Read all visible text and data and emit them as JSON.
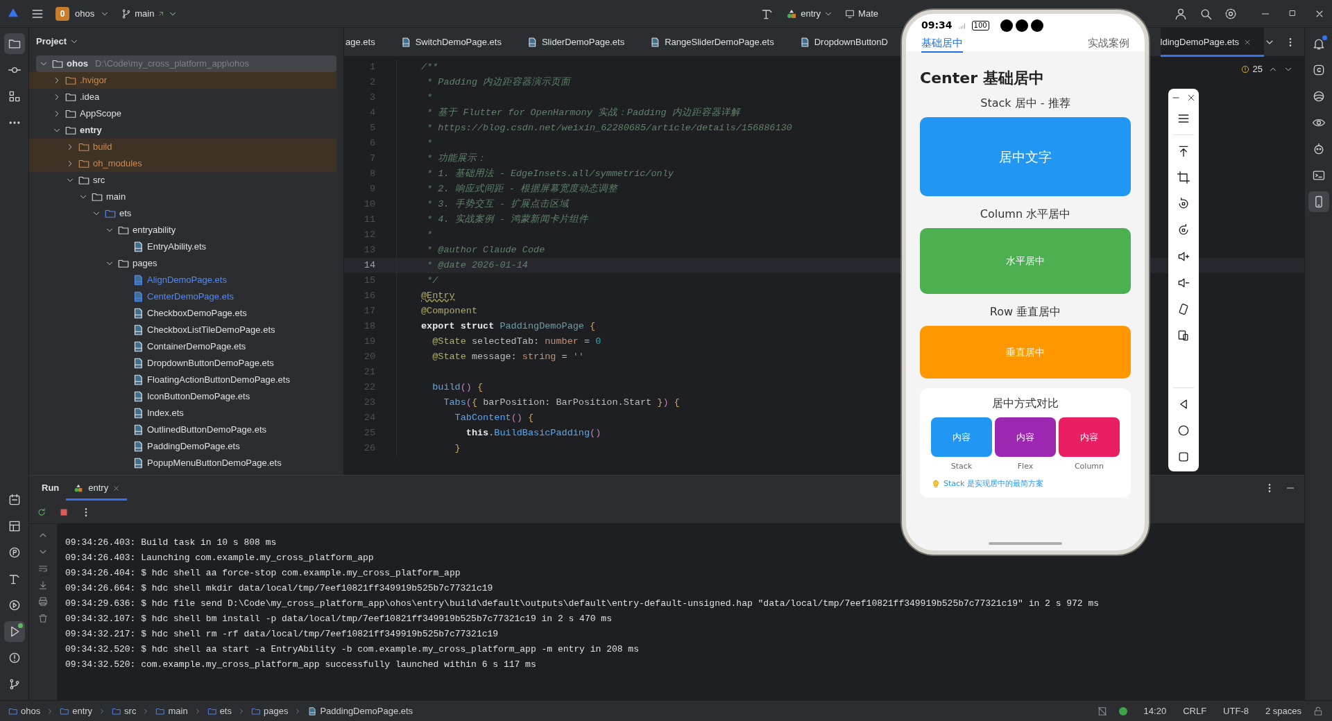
{
  "top_bar": {
    "project_badge": "0",
    "project": "ohos",
    "branch": "main",
    "run_config": "entry",
    "device": "Mate"
  },
  "project_panel": {
    "title": "Project",
    "tree": [
      {
        "name": "ohos",
        "path": "D:\\Code\\my_cross_platform_app\\ohos",
        "kind": "module",
        "expanded": true,
        "selected": true,
        "children": [
          {
            "name": ".hvigor",
            "kind": "folder",
            "expanded": false,
            "selected": false,
            "excluded": true
          },
          {
            "name": ".idea",
            "kind": "folder",
            "expanded": false,
            "selected": false
          },
          {
            "name": "AppScope",
            "kind": "folder",
            "expanded": false,
            "selected": false
          },
          {
            "name": "entry",
            "kind": "module",
            "expanded": true,
            "selected": false,
            "children": [
              {
                "name": "build",
                "kind": "folder",
                "expanded": false,
                "selected": false,
                "excluded": true
              },
              {
                "name": "oh_modules",
                "kind": "folder",
                "expanded": false,
                "selected": false,
                "excluded": true
              },
              {
                "name": "src",
                "kind": "folder",
                "expanded": true,
                "selected": false,
                "children": [
                  {
                    "name": "main",
                    "kind": "folder",
                    "expanded": true,
                    "selected": false,
                    "children": [
                      {
                        "name": "ets",
                        "kind": "source",
                        "expanded": true,
                        "selected": false,
                        "children": [
                          {
                            "name": "entryability",
                            "kind": "folder",
                            "expanded": true,
                            "selected": false,
                            "children": [
                              {
                                "name": "EntryAbility.ets",
                                "kind": "file",
                                "selected": false
                              }
                            ]
                          },
                          {
                            "name": "pages",
                            "kind": "folder",
                            "expanded": true,
                            "selected": false,
                            "children": [
                              {
                                "name": "AlignDemoPage.ets",
                                "kind": "file",
                                "selected": false,
                                "modified": true
                              },
                              {
                                "name": "CenterDemoPage.ets",
                                "kind": "file",
                                "selected": false,
                                "modified": true
                              },
                              {
                                "name": "CheckboxDemoPage.ets",
                                "kind": "file",
                                "selected": false
                              },
                              {
                                "name": "CheckboxListTileDemoPage.ets",
                                "kind": "file",
                                "selected": false
                              },
                              {
                                "name": "ContainerDemoPage.ets",
                                "kind": "file",
                                "selected": false
                              },
                              {
                                "name": "DropdownButtonDemoPage.ets",
                                "kind": "file",
                                "selected": false
                              },
                              {
                                "name": "FloatingActionButtonDemoPage.ets",
                                "kind": "file",
                                "selected": false
                              },
                              {
                                "name": "IconButtonDemoPage.ets",
                                "kind": "file",
                                "selected": false
                              },
                              {
                                "name": "Index.ets",
                                "kind": "file",
                                "selected": false
                              },
                              {
                                "name": "OutlinedButtonDemoPage.ets",
                                "kind": "file",
                                "selected": false
                              },
                              {
                                "name": "PaddingDemoPage.ets",
                                "kind": "file",
                                "selected": false
                              },
                              {
                                "name": "PopupMenuButtonDemoPage.ets",
                                "kind": "file",
                                "selected": false
                              }
                            ]
                          }
                        ]
                      }
                    ]
                  }
                ]
              }
            ]
          }
        ]
      }
    ]
  },
  "editor": {
    "tabs": [
      {
        "label": "age.ets",
        "icon": false,
        "selected": false
      },
      {
        "label": "SwitchDemoPage.ets",
        "icon": true,
        "selected": false
      },
      {
        "label": "SliderDemoPage.ets",
        "icon": true,
        "selected": false
      },
      {
        "label": "RangeSliderDemoPage.ets",
        "icon": true,
        "selected": false
      },
      {
        "label": "DropdownButtonD",
        "icon": true,
        "selected": false
      },
      {
        "label": "ldingDemoPage.ets",
        "icon": false,
        "selected": true
      }
    ],
    "warnings": "25",
    "lines": [
      {
        "num": "1",
        "current": false,
        "tokens": [
          {
            "kind": "comment",
            "text": "/**"
          }
        ]
      },
      {
        "num": "2",
        "current": false,
        "tokens": [
          {
            "kind": "comment",
            "text": " * Padding 内边距容器演示页面"
          }
        ]
      },
      {
        "num": "3",
        "current": false,
        "tokens": [
          {
            "kind": "comment",
            "text": " *"
          }
        ]
      },
      {
        "num": "4",
        "current": false,
        "tokens": [
          {
            "kind": "comment",
            "text": " * 基于 Flutter for OpenHarmony 实战：Padding 内边距容器详解"
          }
        ]
      },
      {
        "num": "5",
        "current": false,
        "tokens": [
          {
            "kind": "comment",
            "text": " * https://blog.csdn.net/weixin_62280685/article/details/156886130"
          }
        ]
      },
      {
        "num": "6",
        "current": false,
        "tokens": [
          {
            "kind": "comment",
            "text": " *"
          }
        ]
      },
      {
        "num": "7",
        "current": false,
        "tokens": [
          {
            "kind": "comment",
            "text": " * 功能展示："
          }
        ]
      },
      {
        "num": "8",
        "current": false,
        "tokens": [
          {
            "kind": "comment",
            "text": " * 1. 基础用法 - EdgeInsets.all/symmetric/only"
          }
        ]
      },
      {
        "num": "9",
        "current": false,
        "tokens": [
          {
            "kind": "comment",
            "text": " * 2. 响应式间距 - 根据屏幕宽度动态调整"
          }
        ]
      },
      {
        "num": "10",
        "current": false,
        "tokens": [
          {
            "kind": "comment",
            "text": " * 3. 手势交互 - 扩展点击区域"
          }
        ]
      },
      {
        "num": "11",
        "current": false,
        "tokens": [
          {
            "kind": "comment",
            "text": " * 4. 实战案例 - 鸿蒙新闻卡片组件"
          }
        ]
      },
      {
        "num": "12",
        "current": false,
        "tokens": [
          {
            "kind": "comment",
            "text": " *"
          }
        ]
      },
      {
        "num": "13",
        "current": false,
        "tokens": [
          {
            "kind": "comment",
            "text": " * @author Claude Code"
          }
        ]
      },
      {
        "num": "14",
        "current": true,
        "tokens": [
          {
            "kind": "comment",
            "text": " * @date 2026-01-14"
          }
        ]
      },
      {
        "num": "15",
        "current": false,
        "tokens": [
          {
            "kind": "comment",
            "text": " */"
          }
        ]
      },
      {
        "num": "16",
        "current": false,
        "tokens": [
          {
            "kind": "annotation-warning",
            "text": "@Entry"
          }
        ]
      },
      {
        "num": "17",
        "current": false,
        "tokens": [
          {
            "kind": "annotation",
            "text": "@Component"
          }
        ]
      },
      {
        "num": "18",
        "current": false,
        "tokens": [
          {
            "kind": "keyword",
            "text": "export struct "
          },
          {
            "kind": "type",
            "text": "PaddingDemoPage "
          },
          {
            "kind": "brace",
            "text": "{"
          }
        ]
      },
      {
        "num": "19",
        "current": false,
        "tokens": [
          {
            "kind": "annotation",
            "text": "  @State"
          },
          {
            "kind": "plain",
            "text": " selectedTab: "
          },
          {
            "kind": "builtin",
            "text": "number"
          },
          {
            "kind": "plain",
            "text": " = "
          },
          {
            "kind": "number",
            "text": "0"
          }
        ]
      },
      {
        "num": "20",
        "current": false,
        "tokens": [
          {
            "kind": "annotation",
            "text": "  @State"
          },
          {
            "kind": "plain",
            "text": " message: "
          },
          {
            "kind": "builtin",
            "text": "string"
          },
          {
            "kind": "plain",
            "text": " = "
          },
          {
            "kind": "string",
            "text": "''"
          }
        ]
      },
      {
        "num": "21",
        "current": false
      },
      {
        "num": "22",
        "current": false,
        "tokens": [
          {
            "kind": "func",
            "text": "  build"
          },
          {
            "kind": "paren",
            "text": "() "
          },
          {
            "kind": "brace",
            "text": "{"
          }
        ]
      },
      {
        "num": "23",
        "current": false,
        "tokens": [
          {
            "kind": "func",
            "text": "    Tabs"
          },
          {
            "kind": "paren",
            "text": "("
          },
          {
            "kind": "brace",
            "text": "{"
          },
          {
            "kind": "plain",
            "text": " barPosition: BarPosition.Start "
          },
          {
            "kind": "brace",
            "text": "}"
          },
          {
            "kind": "paren",
            "text": ") "
          },
          {
            "kind": "brace",
            "text": "{"
          }
        ]
      },
      {
        "num": "24",
        "current": false,
        "tokens": [
          {
            "kind": "func",
            "text": "      TabContent"
          },
          {
            "kind": "paren",
            "text": "() "
          },
          {
            "kind": "brace",
            "text": "{"
          }
        ]
      },
      {
        "num": "25",
        "current": false,
        "tokens": [
          {
            "kind": "keyword",
            "text": "        this"
          },
          {
            "kind": "plain",
            "text": "."
          },
          {
            "kind": "func",
            "text": "BuildBasicPadding"
          },
          {
            "kind": "paren",
            "text": "()"
          }
        ]
      },
      {
        "num": "26",
        "current": false,
        "tokens": [
          {
            "kind": "brace",
            "text": "      }"
          }
        ]
      }
    ]
  },
  "run_panel": {
    "tabs": [
      {
        "label": "Run",
        "selected": false
      },
      {
        "label": "entry",
        "selected": true
      }
    ],
    "console": [
      "09:34:26.403: Build task in 10 s 808 ms",
      "09:34:26.403: Launching com.example.my_cross_platform_app",
      "09:34:26.404: $ hdc shell aa force-stop com.example.my_cross_platform_app",
      "09:34:26.664: $ hdc shell mkdir data/local/tmp/7eef10821ff349919b525b7c77321c19",
      "09:34:29.636: $ hdc file send D:\\Code\\my_cross_platform_app\\ohos\\entry\\build\\default\\outputs\\default\\entry-default-unsigned.hap \"data/local/tmp/7eef10821ff349919b525b7c77321c19\" in 2 s 972 ms",
      "09:34:32.107: $ hdc shell bm install -p data/local/tmp/7eef10821ff349919b525b7c77321c19 in 2 s 470 ms",
      "09:34:32.217: $ hdc shell rm -rf data/local/tmp/7eef10821ff349919b525b7c77321c19",
      "09:34:32.520: $ hdc shell aa start -a EntryAbility -b com.example.my_cross_platform_app -m entry in 208 ms",
      "09:34:32.520: com.example.my_cross_platform_app successfully launched within 6 s 117 ms"
    ]
  },
  "status_bar": {
    "breadcrumbs": [
      "ohos",
      "entry",
      "src",
      "main",
      "ets",
      "pages",
      "PaddingDemoPage.ets"
    ],
    "position": "14:20",
    "line_ending": "CRLF",
    "encoding": "UTF-8",
    "indent": "2 spaces"
  },
  "phone": {
    "time": "09:34",
    "battery": "100",
    "tabs": [
      {
        "label": "基础居中",
        "selected": true
      },
      {
        "label": "实战案例",
        "selected": false
      }
    ],
    "title": "Center 基础居中",
    "sections": [
      {
        "heading": "Stack 居中 - 推荐",
        "box_text": "居中文字",
        "color": "#2196f3"
      },
      {
        "heading": "Column 水平居中",
        "box_text": "水平居中",
        "color": "#4caf50"
      },
      {
        "heading": "Row 垂直居中",
        "box_text": "垂直居中",
        "color": "#ff9800"
      }
    ],
    "compare": {
      "title": "居中方式对比",
      "items": [
        {
          "text": "内容",
          "label": "Stack",
          "color": "#2196f3"
        },
        {
          "text": "内容",
          "label": "Flex",
          "color": "#9c27b0"
        },
        {
          "text": "内容",
          "label": "Column",
          "color": "#e91e63"
        }
      ],
      "tip": "Stack 是实现居中的最简方案"
    }
  }
}
